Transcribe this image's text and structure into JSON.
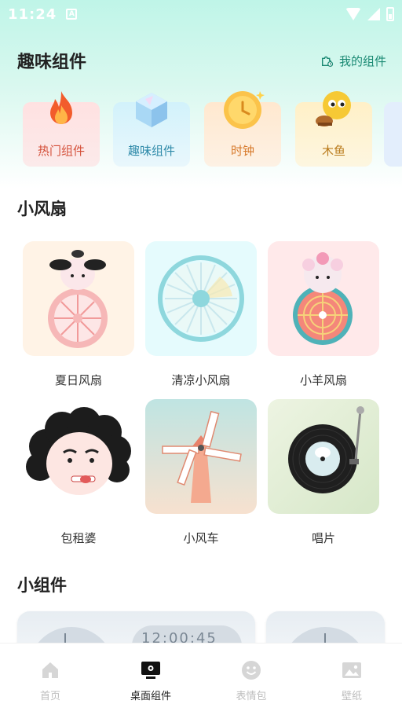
{
  "status_bar": {
    "time": "11:24",
    "notification_glyph": "A"
  },
  "header": {
    "title": "趣味组件",
    "my_widgets_label": "我的组件"
  },
  "categories": [
    {
      "label": "热门组件",
      "icon": "flame-icon",
      "color": "#d4503a"
    },
    {
      "label": "趣味组件",
      "icon": "crystal-cube-icon",
      "color": "#2f8aa9"
    },
    {
      "label": "时钟",
      "icon": "clock-icon",
      "color": "#d77a2b"
    },
    {
      "label": "木鱼",
      "icon": "wooden-fish-icon",
      "color": "#bb7d1f"
    }
  ],
  "fan_section": {
    "title": "小风扇",
    "items": [
      {
        "label": "夏日风扇",
        "icon": "dog-fan-icon"
      },
      {
        "label": "清凉小风扇",
        "icon": "blue-fan-icon"
      },
      {
        "label": "小羊风扇",
        "icon": "sheep-fan-icon"
      },
      {
        "label": "包租婆",
        "icon": "landlady-icon"
      },
      {
        "label": "小风车",
        "icon": "windmill-icon"
      },
      {
        "label": "唱片",
        "icon": "vinyl-record-icon"
      }
    ]
  },
  "widgets_section": {
    "title": "小组件",
    "clock_preview": "12:00:45"
  },
  "bottom_nav": [
    {
      "label": "首页",
      "icon": "home-icon",
      "active": false
    },
    {
      "label": "桌面组件",
      "icon": "desktop-widget-icon",
      "active": true
    },
    {
      "label": "表情包",
      "icon": "smiley-icon",
      "active": false
    },
    {
      "label": "壁纸",
      "icon": "image-icon",
      "active": false
    }
  ],
  "colors": {
    "accent": "#1b8a74",
    "header_gradient_top": "#bff5e8"
  }
}
